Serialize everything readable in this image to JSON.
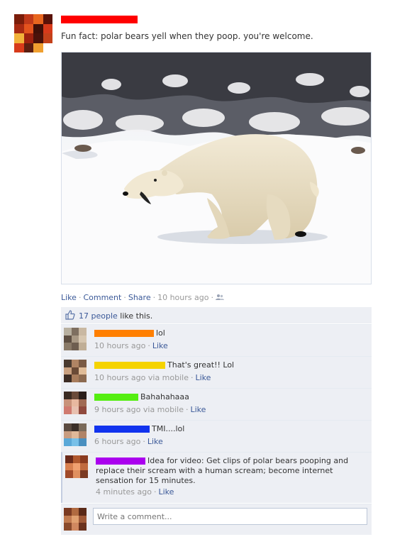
{
  "colors": {
    "link": "#3b5998",
    "redact_author": "#ff0000",
    "redact_c1": "#ff7f00",
    "redact_c2": "#f5d300",
    "redact_c3": "#55ee11",
    "redact_c4": "#1133ee",
    "redact_c5": "#aa00ee"
  },
  "post": {
    "text": "Fun fact: polar bears yell when they poop. you're welcome."
  },
  "actions": {
    "like": "Like",
    "comment": "Comment",
    "share": "Share",
    "time": "10 hours ago",
    "audience_icon": "friends-icon"
  },
  "likes": {
    "icon": "thumbs-up-icon",
    "count_text": "17 people",
    "suffix": " like this."
  },
  "comments": [
    {
      "text": "lol",
      "time": "10 hours ago",
      "via": "",
      "like": "Like"
    },
    {
      "text": "That's great!! Lol",
      "time": "10 hours ago",
      "via": " via mobile",
      "like": "Like"
    },
    {
      "text": "Bahahahaaa",
      "time": "9 hours ago",
      "via": " via mobile",
      "like": "Like"
    },
    {
      "text": "TMI....lol",
      "time": "6 hours ago",
      "via": "",
      "like": "Like"
    },
    {
      "text": "Idea for video: Get clips of polar bears pooping and replace their scream with a human scream; become internet sensation for 15 minutes.",
      "time": "4 minutes ago",
      "via": "",
      "like": "Like"
    }
  ],
  "composer": {
    "placeholder": "Write a comment..."
  }
}
